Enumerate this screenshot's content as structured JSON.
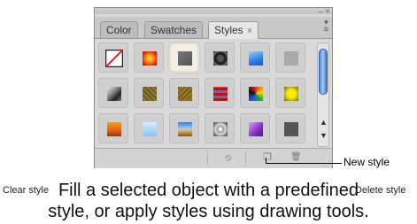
{
  "panel": {
    "tabs": [
      {
        "label": "Color",
        "active": false
      },
      {
        "label": "Swatches",
        "active": false
      },
      {
        "label": "Styles",
        "active": true,
        "close": "×"
      }
    ],
    "window_minimize": "–",
    "window_close": "×",
    "panel_menu_icon": "panel-menu-icon"
  },
  "styles_grid": [
    {
      "name": "no-style",
      "selected": false
    },
    {
      "name": "red-glow",
      "selected": false
    },
    {
      "name": "gray-bevel",
      "selected": true
    },
    {
      "name": "dark-ring",
      "selected": false
    },
    {
      "name": "blue-gel",
      "selected": false
    },
    {
      "name": "light-gray",
      "selected": false
    },
    {
      "name": "dark-chrome",
      "selected": false
    },
    {
      "name": "olive-texture",
      "selected": false
    },
    {
      "name": "brown-texture",
      "selected": false
    },
    {
      "name": "red-stripes",
      "selected": false
    },
    {
      "name": "multicolor",
      "selected": false
    },
    {
      "name": "gold-glow",
      "selected": false
    },
    {
      "name": "sunset",
      "selected": false
    },
    {
      "name": "pale-blue",
      "selected": false
    },
    {
      "name": "landscape",
      "selected": false
    },
    {
      "name": "crackle",
      "selected": false
    },
    {
      "name": "purple-gradient",
      "selected": false
    },
    {
      "name": "dark-gray",
      "selected": false
    }
  ],
  "footer": {
    "clear_icon": "⦸",
    "new_icon": "❐",
    "delete_icon": "🗑"
  },
  "callouts": {
    "new_style": "New style",
    "clear_style": "Clear style",
    "delete_style": "Delete style"
  },
  "caption": {
    "line1": "Fill a selected object with a predefined",
    "line2": "style, or apply styles using drawing tools."
  },
  "colors": {
    "accent_blue": "#4f86d8"
  }
}
